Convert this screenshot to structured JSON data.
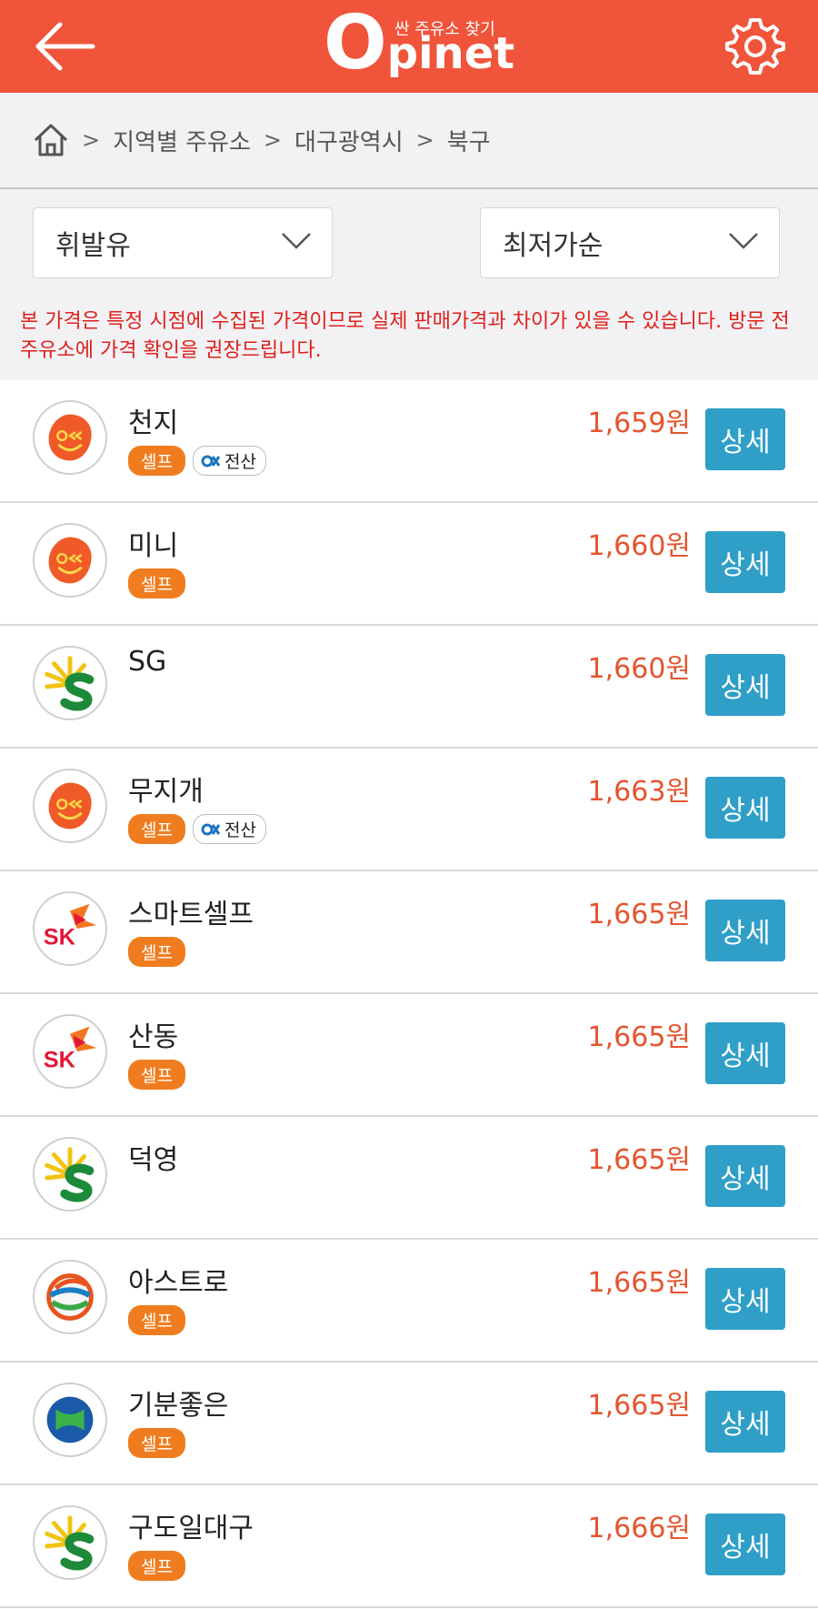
{
  "header": {
    "logo_sub": "싼 주유소 찾기",
    "logo_o": "O",
    "logo_rest": "pinet",
    "back_icon": "arrow-left-icon",
    "settings_icon": "gear-icon",
    "color": "#f0543a"
  },
  "breadcrumb": {
    "home_icon": "home-icon",
    "items": [
      "지역별 주유소",
      "대구광역시",
      "북구"
    ]
  },
  "filters": {
    "fuel": "휘발유",
    "sort": "최저가순"
  },
  "notice": "본 가격은 특정 시점에 수집된 가격이므로 실제 판매가격과 차이가 있을 수 있습니다. 방문 전 주유소에 가격 확인을 권장드립니다.",
  "detail_label": "상세",
  "stations": [
    {
      "name": "천지",
      "brand": "gs-caltex-logo",
      "price": "1,659원",
      "self": "셀프",
      "ok": "전산"
    },
    {
      "name": "미니",
      "brand": "gs-caltex-logo",
      "price": "1,660원",
      "self": "셀프"
    },
    {
      "name": "SG",
      "brand": "s-oil-logo",
      "price": "1,660원"
    },
    {
      "name": "무지개",
      "brand": "gs-caltex-logo",
      "price": "1,663원",
      "self": "셀프",
      "ok": "전산"
    },
    {
      "name": "스마트셀프",
      "brand": "sk-energy-logo",
      "price": "1,665원",
      "self": "셀프"
    },
    {
      "name": "산동",
      "brand": "sk-energy-logo",
      "price": "1,665원",
      "self": "셀프"
    },
    {
      "name": "덕영",
      "brand": "s-oil-logo",
      "price": "1,665원"
    },
    {
      "name": "아스트로",
      "brand": "hyundai-oilbank-logo",
      "price": "1,665원",
      "self": "셀프"
    },
    {
      "name": "기분좋은",
      "brand": "alddle-logo",
      "price": "1,665원",
      "self": "셀프"
    },
    {
      "name": "구도일대구",
      "brand": "s-oil-logo",
      "price": "1,666원",
      "self": "셀프"
    }
  ]
}
